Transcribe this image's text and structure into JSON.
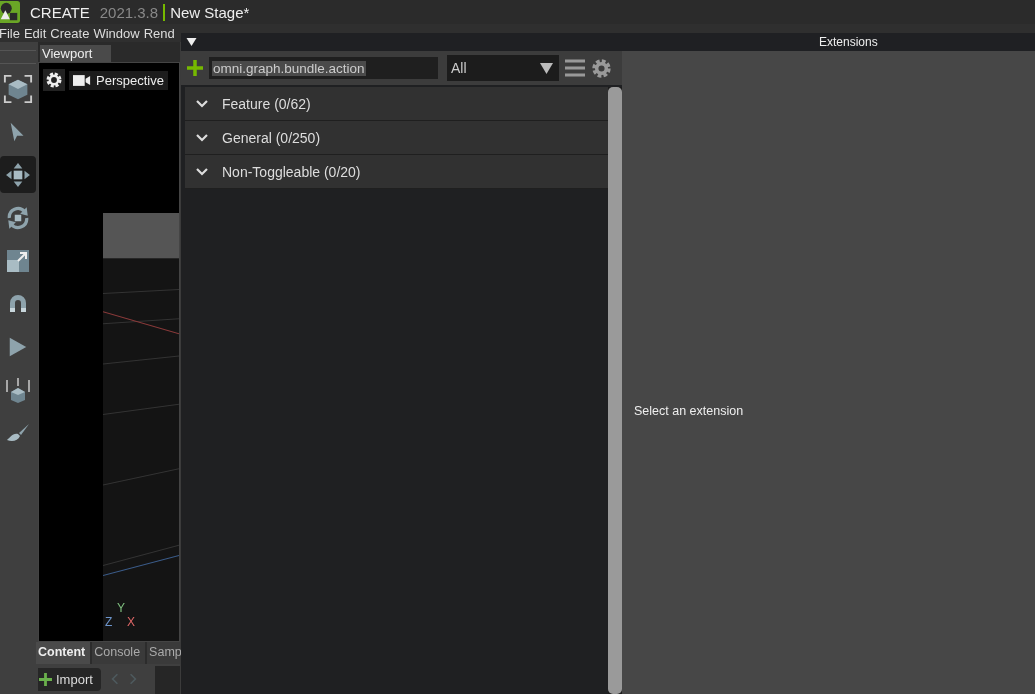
{
  "title_bar": {
    "app": "CREATE",
    "version": "2021.3.8",
    "document": "New Stage*"
  },
  "menu": [
    "File",
    "Edit",
    "Create",
    "Window",
    "Rend"
  ],
  "tools": [
    {
      "kind": "frame",
      "selected": false
    },
    {
      "kind": "select",
      "selected": false
    },
    {
      "kind": "move",
      "selected": true
    },
    {
      "kind": "rotate",
      "selected": false
    },
    {
      "kind": "scale",
      "selected": false
    },
    {
      "kind": "snap",
      "selected": false
    },
    {
      "kind": "play",
      "selected": false
    },
    {
      "kind": "drop",
      "selected": false
    },
    {
      "kind": "paint",
      "selected": false
    }
  ],
  "viewport": {
    "tab": "Viewport",
    "camera": "Perspective",
    "axes": {
      "y": "Y",
      "z": "Z",
      "x": "X"
    }
  },
  "bottom_tabs": [
    {
      "label": "Content",
      "selected": true
    },
    {
      "label": "Console",
      "selected": false
    },
    {
      "label": "Samp",
      "selected": false
    }
  ],
  "import_button": "Import",
  "extensions": {
    "title": "Extensions",
    "search": {
      "value": "omni.graph.bundle.action"
    },
    "filter": "All",
    "categories": [
      {
        "label": "Feature (0/62)",
        "expanded": true
      },
      {
        "label": "General (0/250)",
        "expanded": true
      },
      {
        "label": "Non-Toggleable (0/20)",
        "expanded": true
      }
    ],
    "detail": "Select an extension"
  }
}
